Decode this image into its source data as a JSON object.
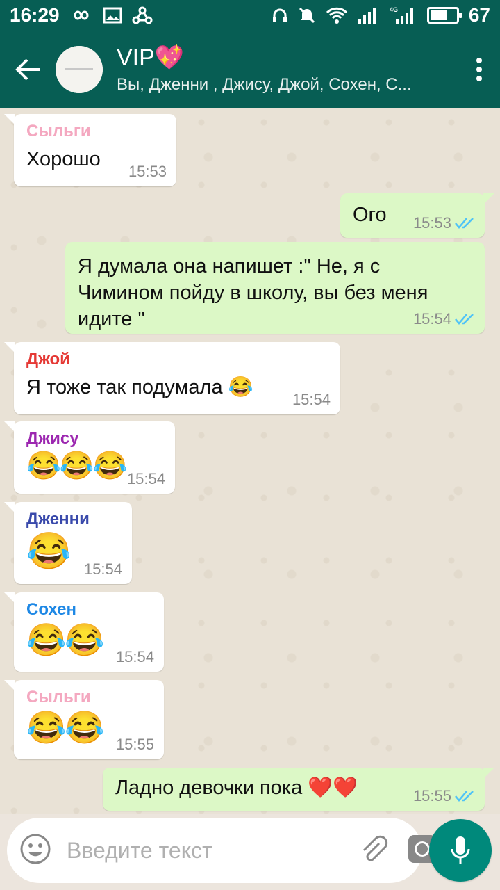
{
  "statusbar": {
    "time": "16:29",
    "battery": "67",
    "battery_fraction": 0.67,
    "network": "4G"
  },
  "header": {
    "title": "VIP💖",
    "subtitle": "Вы, Дженни , Джису, Джой, Сохен, С..."
  },
  "messages": [
    {
      "dir": "in",
      "sender": "Сыльги",
      "sender_color": "#f4a8c0",
      "text": "Хорошо",
      "time": "15:53"
    },
    {
      "dir": "out",
      "text": "Ого",
      "time": "15:53",
      "read": true
    },
    {
      "dir": "out",
      "text": "Я думала  она напишет  :\" Не, я с Чимином пойду в школу, вы без меня идите \"",
      "time": "15:54",
      "read": true
    },
    {
      "dir": "in",
      "sender": "Джой",
      "sender_color": "#e53935",
      "text": "Я тоже так подумала 😂",
      "time": "15:54"
    },
    {
      "dir": "in",
      "sender": "Джису",
      "sender_color": "#9c27b0",
      "text": "😂😂😂",
      "time": "15:54"
    },
    {
      "dir": "in",
      "sender": "Дженни",
      "sender_color": "#3949ab",
      "text": "😂",
      "time": "15:54"
    },
    {
      "dir": "in",
      "sender": "Сохен",
      "sender_color": "#1e88e5",
      "text": "😂😂",
      "time": "15:54"
    },
    {
      "dir": "in",
      "sender": "Сыльги",
      "sender_color": "#f4a8c0",
      "text": "😂😂",
      "time": "15:55"
    },
    {
      "dir": "out",
      "text": "Ладно девочки пока ❤️❤️",
      "time": "15:55",
      "read": true
    }
  ],
  "input": {
    "placeholder": "Введите текст"
  },
  "colors": {
    "header": "#075e54",
    "incoming": "#ffffff",
    "outgoing": "#dcf8c6",
    "accent": "#00897b",
    "read_ticks": "#4fc3f7"
  }
}
